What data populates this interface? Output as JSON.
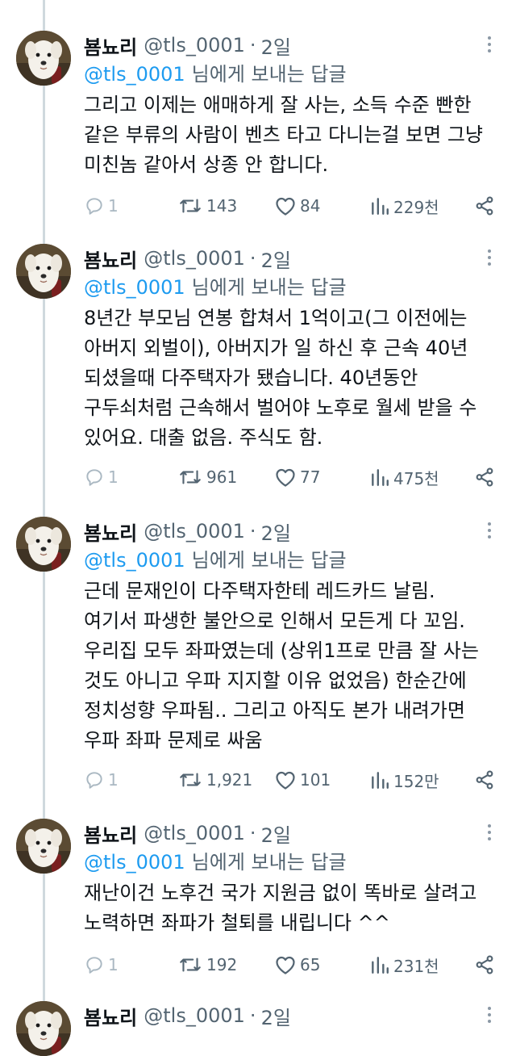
{
  "tweets": [
    {
      "name": "뵴뇨리",
      "handle": "@tls_0001",
      "sep": "·",
      "time": "2일",
      "reply_mention": "@tls_0001",
      "reply_suffix": "님에게 보내는 답글",
      "lines": [
        "그리고 이제는 애매하게 잘 사는, 소득 수준 빤한",
        "같은 부류의 사람이 벤츠 타고 다니는걸 보면 그냥",
        "미친놈 같아서 상종 안 합니다."
      ],
      "replies": "1",
      "retweets": "143",
      "likes": "84",
      "views": "229천"
    },
    {
      "name": "뵴뇨리",
      "handle": "@tls_0001",
      "sep": "·",
      "time": "2일",
      "reply_mention": "@tls_0001",
      "reply_suffix": "님에게 보내는 답글",
      "lines": [
        "8년간 부모님 연봉 합쳐서 1억이고(그 이전에는",
        "아버지 외벌이), 아버지가 일 하신 후 근속 40년",
        "되셨을때 다주택자가 됐습니다. 40년동안",
        "구두쇠처럼 근속해서 벌어야 노후로 월세 받을 수",
        "있어요. 대출 없음. 주식도 함."
      ],
      "replies": "1",
      "retweets": "961",
      "likes": "77",
      "views": "475천"
    },
    {
      "name": "뵴뇨리",
      "handle": "@tls_0001",
      "sep": "·",
      "time": "2일",
      "reply_mention": "@tls_0001",
      "reply_suffix": "님에게 보내는 답글",
      "lines": [
        "근데 문재인이 다주택자한테 레드카드 날림.",
        "여기서 파생한 불안으로 인해서 모든게 다 꼬임.",
        "우리집 모두 좌파였는데 (상위1프로 만큼 잘 사는",
        "것도 아니고 우파 지지할 이유 없었음) 한순간에",
        "정치성향 우파됨.. 그리고 아직도 본가 내려가면",
        "우파 좌파 문제로 싸움"
      ],
      "replies": "1",
      "retweets": "1,921",
      "likes": "101",
      "views": "152만"
    },
    {
      "name": "뵴뇨리",
      "handle": "@tls_0001",
      "sep": "·",
      "time": "2일",
      "reply_mention": "@tls_0001",
      "reply_suffix": "님에게 보내는 답글",
      "lines": [
        "재난이건 노후건 국가 지원금 없이 똑바로 살려고",
        "노력하면 좌파가 철퇴를 내립니다 ^^"
      ],
      "replies": "1",
      "retweets": "192",
      "likes": "65",
      "views": "231천"
    },
    {
      "name": "뵴뇨리",
      "handle": "@tls_0001",
      "sep": "·",
      "time": "2일"
    }
  ],
  "colors": {
    "accent": "#1d9bf0",
    "muted": "#536471",
    "text": "#0f1419",
    "thread": "#cfd9de"
  },
  "icons": [
    "reply-icon",
    "retweet-icon",
    "like-icon",
    "views-icon",
    "share-icon",
    "more-icon"
  ]
}
